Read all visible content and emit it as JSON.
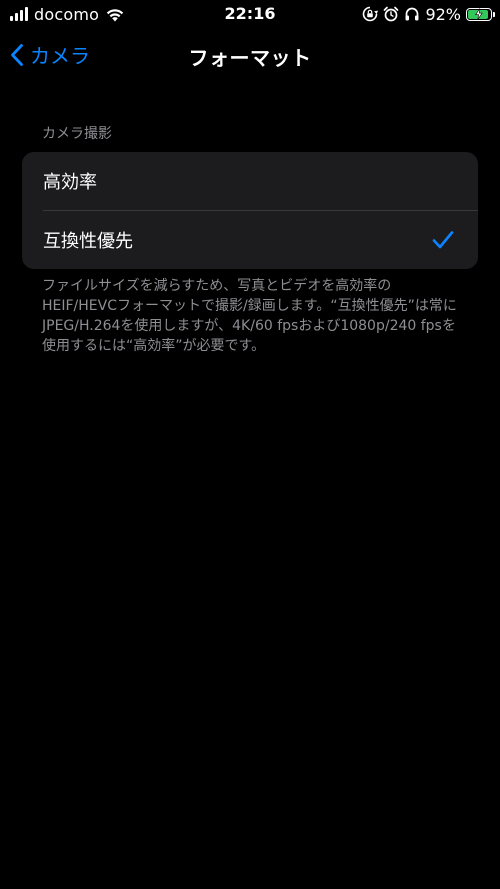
{
  "status_bar": {
    "carrier": "docomo",
    "time": "22:16",
    "battery_percent_label": "92%",
    "battery_level": 0.92
  },
  "nav": {
    "back_label": "カメラ",
    "title": "フォーマット"
  },
  "section": {
    "header": "カメラ撮影",
    "options": [
      {
        "label": "高効率",
        "selected": false
      },
      {
        "label": "互換性優先",
        "selected": true
      }
    ],
    "footer": "ファイルサイズを減らすため、写真とビデオを高効率のHEIF/HEVCフォーマットで撮影/録画します。“互換性優先”は常にJPEG/H.264を使用しますが、4K/60 fpsおよび1080p/240 fpsを使用するには“高効率”が必要です。"
  },
  "colors": {
    "background": "#000000",
    "accent": "#0a84ff",
    "cell": "#1c1c1e",
    "secondary_text": "#8e8e93",
    "battery_charging": "#34c759"
  },
  "icons": [
    "signal-bars-icon",
    "wifi-icon",
    "screen-rotation-lock-icon",
    "alarm-icon",
    "headphones-icon",
    "battery-charging-icon",
    "chevron-left-icon",
    "checkmark-icon"
  ]
}
